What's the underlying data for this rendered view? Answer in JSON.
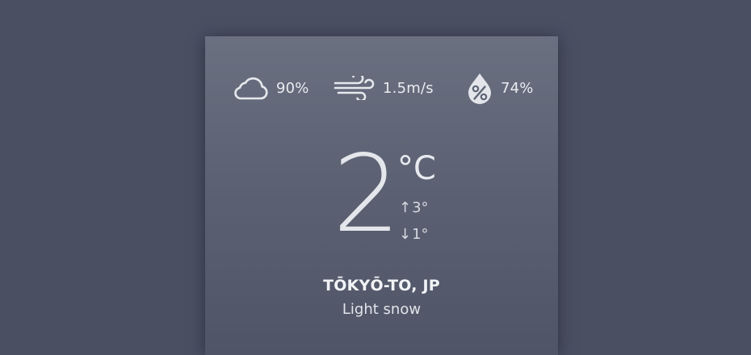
{
  "weather": {
    "clouds": {
      "icon": "cloud-icon",
      "value": "90%"
    },
    "wind": {
      "icon": "wind-icon",
      "value": "1.5m/s"
    },
    "humidity": {
      "icon": "humidity-drop-icon",
      "value": "74%"
    },
    "temperature": {
      "value": "2",
      "unit": "°C"
    },
    "high": {
      "icon": "arrow-up-icon",
      "arrow": "↑",
      "value": "3°"
    },
    "low": {
      "icon": "arrow-down-icon",
      "arrow": "↓",
      "value": "1°"
    },
    "location": "TŌKYŌ-TO, JP",
    "condition": "Light snow"
  },
  "colors": {
    "background": "#4a5062",
    "card_top": "#6a7080",
    "card_bottom": "#4f5567",
    "text": "#e9ebf0"
  }
}
